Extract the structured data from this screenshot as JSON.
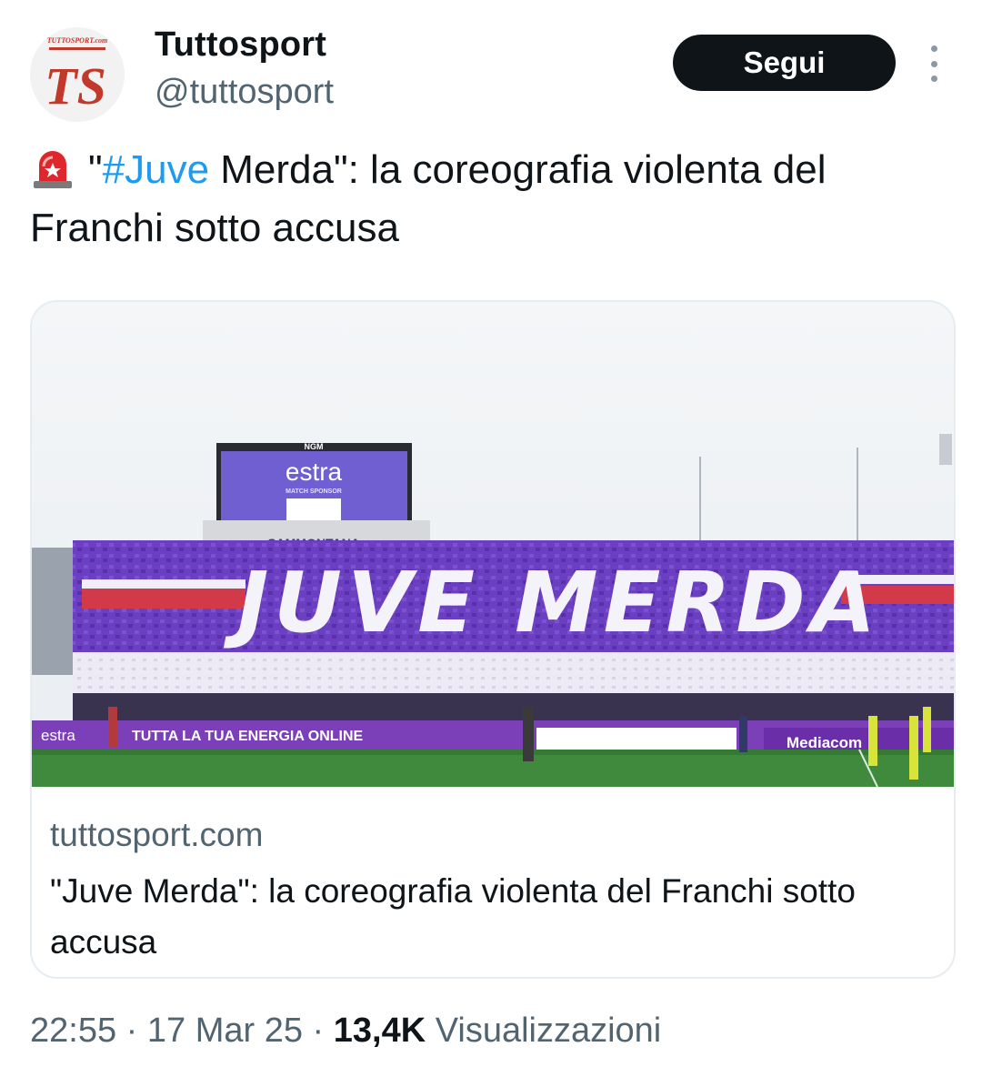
{
  "author": {
    "display_name": "Tuttosport",
    "handle": "@tuttosport",
    "avatar_logo_text": "TS",
    "avatar_wordmark": "TUTTOSPORT.com"
  },
  "follow_button": {
    "label": "Segui"
  },
  "tweet": {
    "emoji": "police-siren-icon",
    "text_before_hashtag": "\"",
    "hashtag": "#Juve",
    "text_after_hashtag": " Merda\": la coreografia violenta del Franchi sotto accusa"
  },
  "link_card": {
    "domain": "tuttosport.com",
    "title": "\"Juve Merda\": la coreografia violenta del Franchi sotto accusa",
    "image": {
      "banner_text": "JUVE MERDA",
      "scoreboard_brand": "estra",
      "scoreboard_sponsor": "MATCH SPONSOR",
      "scoreboard_top": "NGM",
      "stand_text": "SAMMONTANA",
      "board_brand": "estra",
      "board_slogan": "TUTTA LA TUA ENERGIA ONLINE",
      "board_right": "Mediacom"
    }
  },
  "meta": {
    "time": "22:55",
    "separator": " · ",
    "date": "17 Mar 25",
    "views_count": "13,4K",
    "views_label": " Visualizzazioni"
  },
  "colors": {
    "follow_bg": "#0f1419",
    "hashtag": "#1d9bf0",
    "secondary_text": "#536471",
    "viola": "#6a3fc0"
  }
}
